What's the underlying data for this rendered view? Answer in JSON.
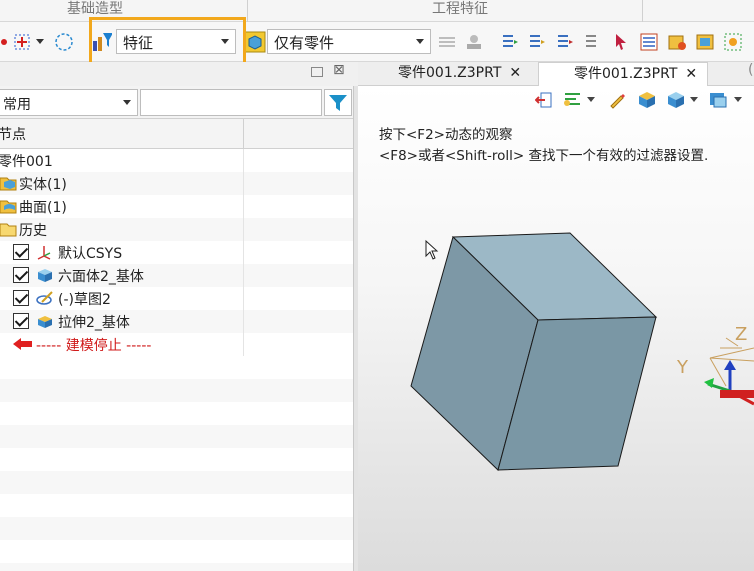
{
  "ribbon": {
    "group_basic": "基础造型",
    "group_engineering": "工程特征"
  },
  "toolbar": {
    "filter_combo_value": "特征",
    "part_combo_value": "仅有零件"
  },
  "left_panel": {
    "filter_select_value": "常用",
    "filter_search_value": "",
    "column_node": "节点",
    "tree": [
      {
        "label": "零件001"
      },
      {
        "label": "实体(1)"
      },
      {
        "label": "曲面(1)"
      },
      {
        "label": "历史"
      },
      {
        "label": "默认CSYS",
        "checked": true
      },
      {
        "label": "六面体2_基体",
        "checked": true
      },
      {
        "label": "(-)草图2",
        "checked": true
      },
      {
        "label": "拉伸2_基体",
        "checked": true
      },
      {
        "label": "----- 建模停止 -----"
      }
    ]
  },
  "tabs": [
    {
      "label": "零件001.Z3PRT",
      "close": "✕"
    },
    {
      "label": "零件001.Z3PRT",
      "close": "✕"
    }
  ],
  "viewport": {
    "hint_line1": "按下<F2>动态的观察",
    "hint_line2": "<F8>或者<Shift-roll> 查找下一个有效的过滤器设置.",
    "axis_z": "Z",
    "axis_y": "Y"
  },
  "colors": {
    "highlight": "#f2a81c",
    "stop_text": "#d01a1a",
    "cube_top": "#9cb8c6",
    "cube_left": "#7d98a6",
    "cube_right": "#7a97a5"
  }
}
